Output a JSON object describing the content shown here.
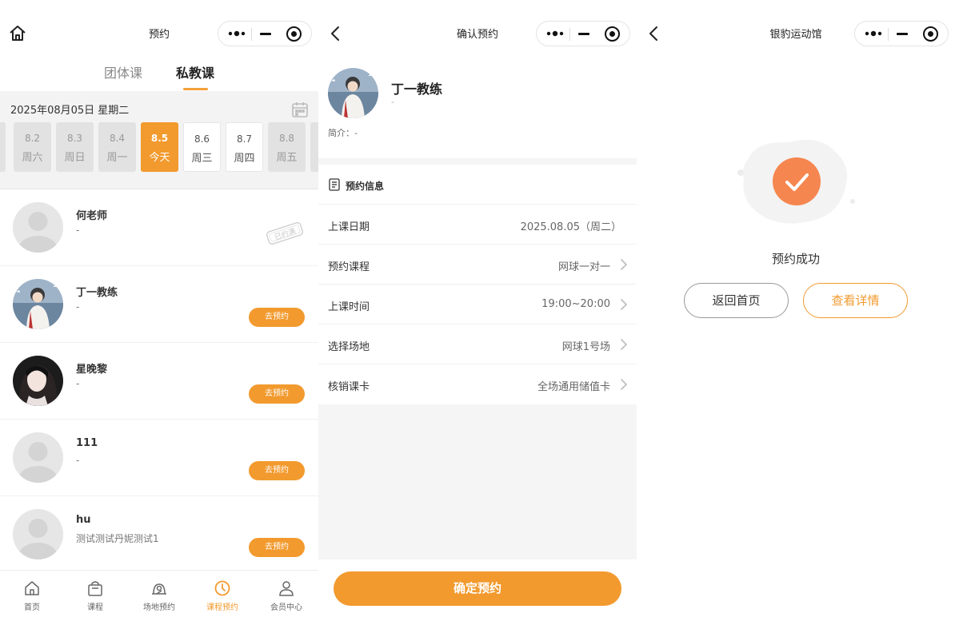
{
  "capsule_icons": [
    "more-dots-icon",
    "minimize-icon",
    "close-target-icon"
  ],
  "colors": {
    "accent": "#f29a2e",
    "success": "#f6864f",
    "muted": "#999999"
  },
  "screen1": {
    "title": "预约",
    "tabs": [
      "团体课",
      "私教课"
    ],
    "active_tab": "私教课",
    "date_label": "2025年08月05日 星期二",
    "days": [
      {
        "date": "8.2",
        "week": "周六",
        "state": "past"
      },
      {
        "date": "8.3",
        "week": "周日",
        "state": "past"
      },
      {
        "date": "8.4",
        "week": "周一",
        "state": "past"
      },
      {
        "date": "8.5",
        "week": "今天",
        "state": "today"
      },
      {
        "date": "8.6",
        "week": "周三",
        "state": "future"
      },
      {
        "date": "8.7",
        "week": "周四",
        "state": "future"
      },
      {
        "date": "8.8",
        "week": "周五",
        "state": "past"
      }
    ],
    "coaches": [
      {
        "name": "何老师",
        "desc": "-",
        "status": "已约满",
        "button": ""
      },
      {
        "name": "丁一教练",
        "desc": "-",
        "status": "",
        "button": "去预约"
      },
      {
        "name": "星晚黎",
        "desc": "-",
        "status": "",
        "button": "去预约"
      },
      {
        "name": "111",
        "desc": "-",
        "status": "",
        "button": "去预约"
      },
      {
        "name": "hu",
        "desc": "测试测试丹妮测试1",
        "status": "",
        "button": "去预约"
      }
    ],
    "tabbar": [
      {
        "label": "首页",
        "icon": "home-icon"
      },
      {
        "label": "课程",
        "icon": "bag-icon"
      },
      {
        "label": "场地预约",
        "icon": "venue-icon"
      },
      {
        "label": "课程预约",
        "icon": "clock-icon"
      },
      {
        "label": "会员中心",
        "icon": "user-icon"
      }
    ],
    "active_tabbar": "课程预约"
  },
  "screen2": {
    "title": "确认预约",
    "coach_name": "丁一教练",
    "coach_sub": "-",
    "intro": "简介：-",
    "info_title": "预约信息",
    "rows": [
      {
        "label": "上课日期",
        "value": "2025.08.05（周二）"
      },
      {
        "label": "预约课程",
        "value": "网球一对一"
      },
      {
        "label": "上课时间",
        "value": "19:00~20:00"
      },
      {
        "label": "选择场地",
        "value": "网球1号场"
      },
      {
        "label": "核销课卡",
        "value": "全场通用储值卡"
      }
    ],
    "confirm_label": "确定预约"
  },
  "screen3": {
    "title": "银豹运动馆",
    "success_text": "预约成功",
    "home_label": "返回首页",
    "detail_label": "查看详情"
  }
}
